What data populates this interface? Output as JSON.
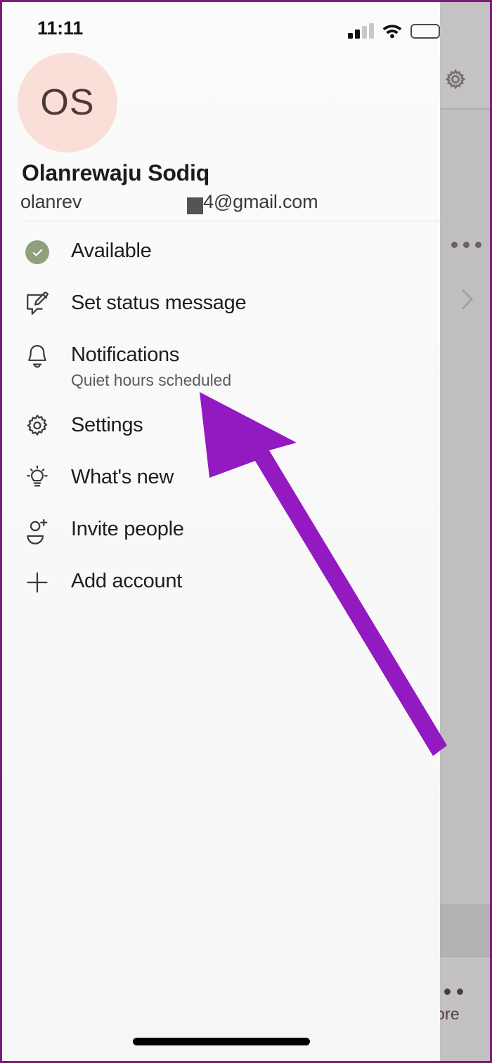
{
  "status_bar": {
    "time": "11:11",
    "signal_icon": "cellular-signal-icon",
    "signal_bars_active": 2,
    "signal_bars_total": 4,
    "wifi_icon": "wifi-icon",
    "battery_icon": "battery-icon",
    "battery_level_percent": 38
  },
  "profile": {
    "avatar_initials": "OS",
    "avatar_color": "#fadfd8",
    "avatar_text_color": "#4c3a35",
    "name": "Olanrewaju Sodiq",
    "email_visible_start": "olanrev",
    "email_visible_end": "4@gmail.com",
    "email_redacted": true
  },
  "menu": {
    "items": [
      {
        "id": "available",
        "label": "Available",
        "sub": "",
        "icon": "check-circle-icon",
        "icon_color": "#90a07d"
      },
      {
        "id": "set-status-message",
        "label": "Set status message",
        "sub": "",
        "icon": "edit-message-icon",
        "icon_color": "#3a3939"
      },
      {
        "id": "notifications",
        "label": "Notifications",
        "sub": "Quiet hours scheduled",
        "icon": "bell-icon",
        "icon_color": "#3a3939"
      },
      {
        "id": "settings",
        "label": "Settings",
        "sub": "",
        "icon": "gear-icon",
        "icon_color": "#3a3939"
      },
      {
        "id": "whats-new",
        "label": "What's new",
        "sub": "",
        "icon": "lightbulb-icon",
        "icon_color": "#3a3939"
      },
      {
        "id": "invite-people",
        "label": "Invite people",
        "sub": "",
        "icon": "person-add-icon",
        "icon_color": "#3a3939"
      },
      {
        "id": "add-account",
        "label": "Add account",
        "sub": "",
        "icon": "plus-icon",
        "icon_color": "#3a3939"
      }
    ]
  },
  "backdrop": {
    "gear_icon": "gear-icon",
    "overflow_icon": "more-horizontal-icon",
    "chevron_icon": "chevron-right-icon",
    "tab_label": "ore",
    "tab_icon": "more-dots-icon"
  },
  "annotation": {
    "arrow_color": "#9319c1",
    "arrow_points_to": "notifications"
  },
  "home_indicator": {
    "visible": true
  }
}
